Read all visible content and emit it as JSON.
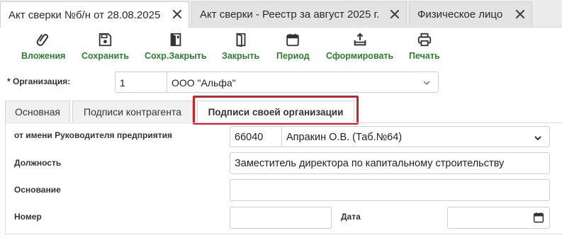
{
  "doc_tabs": [
    {
      "label": "Акт сверки №б/н от 28.08.2025",
      "active": true
    },
    {
      "label": "Акт сверки - Реестр за август 2025 г.",
      "active": false
    },
    {
      "label": "Физическое лицо",
      "active": false
    }
  ],
  "toolbar": {
    "attachments": "Вложения",
    "save": "Сохранить",
    "save_close": "Сохр.Закрыть",
    "close": "Закрыть",
    "period": "Период",
    "generate": "Сформировать",
    "print": "Печать"
  },
  "organization": {
    "label": "* Организация:",
    "code": "1",
    "name": "ООО \"Альфа\""
  },
  "section_tabs": [
    {
      "label": "Основная"
    },
    {
      "label": "Подписи контрагента"
    },
    {
      "label": "Подписи своей организации"
    }
  ],
  "form": {
    "on_behalf_label": "от имени Руководителя предприятия",
    "on_behalf_code": "66040",
    "on_behalf_name": "Апракин О.В. (Таб.№64)",
    "position_label": "Должность",
    "position_value": "Заместитель директора по капитальному строительству",
    "basis_label": "Основание",
    "basis_value": "",
    "number_label": "Номер",
    "number_value": "",
    "date_label": "Дата",
    "date_value": ""
  },
  "colors": {
    "toolbar_accent": "#2e7d32",
    "highlight": "#d32027"
  },
  "icons": {
    "tab_close": "close-icon",
    "attachments": "paperclip-icon",
    "save": "floppy-disk-icon",
    "save_close": "save-close-icon",
    "close": "door-icon",
    "period": "calendar-icon",
    "generate": "upload-tray-icon",
    "print": "printer-icon",
    "dropdown": "chevron-down-icon",
    "date_picker": "calendar-icon"
  }
}
